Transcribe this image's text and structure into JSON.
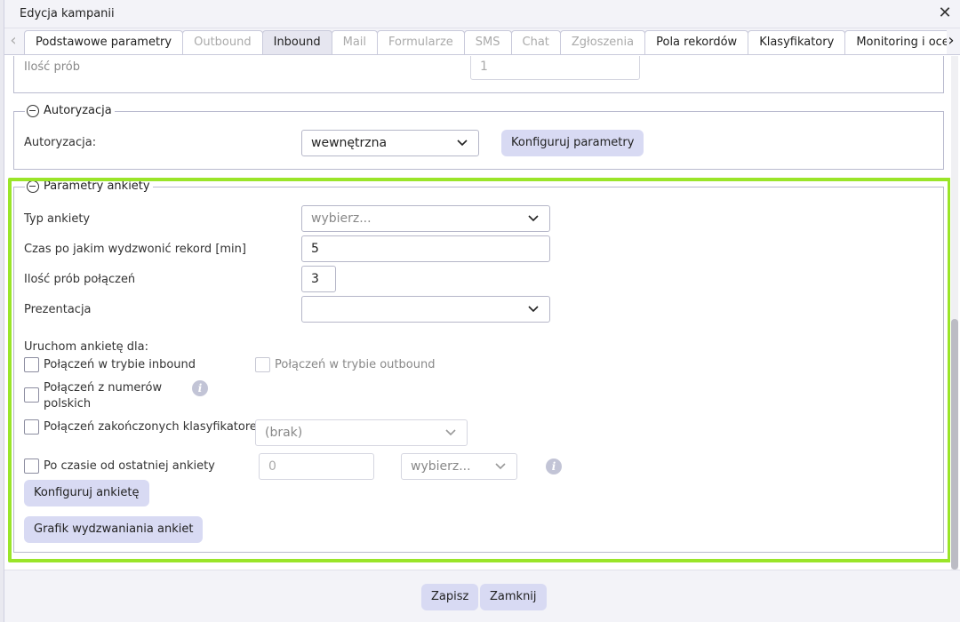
{
  "window": {
    "title": "Edycja kampanii"
  },
  "tabs": [
    {
      "label": "Podstawowe parametry",
      "state": "normal"
    },
    {
      "label": "Outbound",
      "state": "disabled"
    },
    {
      "label": "Inbound",
      "state": "active"
    },
    {
      "label": "Mail",
      "state": "disabled"
    },
    {
      "label": "Formularze",
      "state": "disabled"
    },
    {
      "label": "SMS",
      "state": "disabled"
    },
    {
      "label": "Chat",
      "state": "disabled"
    },
    {
      "label": "Zgłoszenia",
      "state": "disabled"
    },
    {
      "label": "Pola rekordów",
      "state": "normal"
    },
    {
      "label": "Klasyfikatory",
      "state": "normal"
    },
    {
      "label": "Monitoring i ocena",
      "state": "normal"
    }
  ],
  "top_section": {
    "attempts_label": "Ilość prób",
    "attempts_value": "1"
  },
  "auth_section": {
    "legend": "Autoryzacja",
    "auth_label": "Autoryzacja:",
    "auth_value": "wewnętrzna",
    "configure_button": "Konfiguruj parametry"
  },
  "survey_section": {
    "legend": "Parametry ankiety",
    "type_label": "Typ ankiety",
    "type_placeholder": "wybierz...",
    "delay_label": "Czas po jakim wydzwonić rekord [min]",
    "delay_value": "5",
    "call_attempts_label": "Ilość prób połączeń",
    "call_attempts_value": "3",
    "presentation_label": "Prezentacja",
    "presentation_value": "",
    "launch_for_label": "Uruchom ankietę dla:",
    "inbound_checkbox_label": "Połączeń w trybie inbound",
    "outbound_checkbox_label": "Połączeń w trybie outbound",
    "polish_numbers_label_line1": "Połączeń z numerów",
    "polish_numbers_label_line2": "polskich",
    "classifier_checkbox_label": "Połączeń zakończonych klasyfikatorem",
    "classifier_select_value": "(brak)",
    "since_last_label": "Po czasie od ostatniej ankiety",
    "since_last_value": "0",
    "since_last_unit_placeholder": "wybierz...",
    "configure_survey_button": "Konfiguruj ankietę",
    "schedule_button": "Grafik wydzwaniania ankiet"
  },
  "footer": {
    "save_button": "Zapisz",
    "close_button": "Zamknij"
  },
  "colors": {
    "highlight": "#9ae529",
    "button_bg": "#d8daf3"
  }
}
